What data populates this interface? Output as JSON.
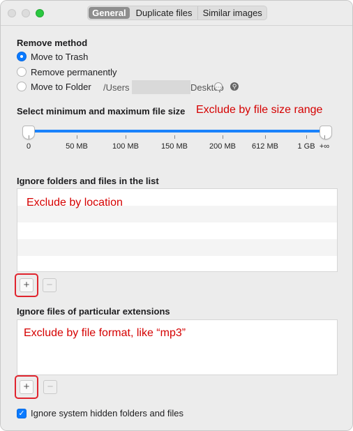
{
  "tabs": [
    {
      "label": "General",
      "selected": true
    },
    {
      "label": "Duplicate files",
      "selected": false
    },
    {
      "label": "Similar images",
      "selected": false
    }
  ],
  "remove_method": {
    "title": "Remove method",
    "options": [
      {
        "label": "Move to Trash",
        "selected": true
      },
      {
        "label": "Remove permanently",
        "selected": false
      },
      {
        "label": "Move to Folder",
        "selected": false
      }
    ],
    "folder_path_start": "/Users",
    "folder_path_end": "Desktop",
    "more_icon": "ellipsis-circle-icon",
    "reveal_icon": "magnifier-icon"
  },
  "file_size": {
    "title": "Select minimum and maximum file size",
    "annotation": "Exclude by file size range",
    "tick_labels": [
      "0",
      "50 MB",
      "100 MB",
      "150 MB",
      "200 MB",
      "612 MB",
      "1 GB",
      "+∞"
    ],
    "range": {
      "min": "0",
      "max": "+∞"
    }
  },
  "ignore_folders": {
    "title": "Ignore folders and files in the list",
    "annotation": "Exclude by location",
    "add_label": "+",
    "remove_label": "−"
  },
  "ignore_extensions": {
    "title": "Ignore files of particular extensions",
    "annotation": "Exclude by file format, like “mp3”",
    "add_label": "+",
    "remove_label": "−"
  },
  "hidden_files": {
    "label": "Ignore system hidden folders and files",
    "checked": true
  },
  "colors": {
    "accent": "#0a7aff",
    "annotation_red": "#d50000",
    "highlight_red": "#e0242e"
  }
}
